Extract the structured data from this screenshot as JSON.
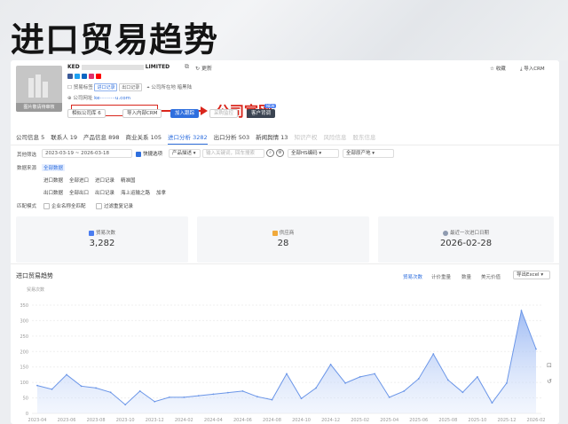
{
  "banner": {
    "title": "进口贸易趋势"
  },
  "company": {
    "logo_tag": "图片敬请待审核",
    "name_prefix": "KED",
    "name_suffix": "LIMITED",
    "update_label": "更新",
    "info_row1": {
      "label": "贸易标签",
      "pill1": "进口记录",
      "pill2": "出口记录",
      "addr_label": "公司所在地",
      "addr_value": "暗黑陆"
    },
    "info_row2": {
      "label": "公司网址",
      "url": "ke··········u.com"
    },
    "official_label": "公司官网"
  },
  "actions": {
    "compare": "相似公司库 6",
    "import_crm": "导入内部CRM",
    "follow": "加入跟踪",
    "disabled": "采购监控",
    "customer_profile": "客户背调",
    "new_badge": "NEW"
  },
  "top_right": {
    "collect": "收藏",
    "crm": "导入CRM"
  },
  "tabs": [
    {
      "label": "公司信息 5",
      "state": "normal"
    },
    {
      "label": "联系人 19",
      "state": "normal"
    },
    {
      "label": "产品信息 898",
      "state": "normal"
    },
    {
      "label": "商业关系 105",
      "state": "normal"
    },
    {
      "label": "进口分析 3282",
      "state": "active"
    },
    {
      "label": "出口分析 503",
      "state": "normal"
    },
    {
      "label": "新闻舆情 13",
      "state": "normal"
    },
    {
      "label": "知识产权",
      "state": "muted"
    },
    {
      "label": "风险信息",
      "state": "muted"
    },
    {
      "label": "股东信息",
      "state": "muted"
    }
  ],
  "filters": {
    "other_label": "其他筛选",
    "date_range": "2023-03-19  ~  2026-03-18",
    "quick": "快捷选项",
    "product_desc": "产品描述",
    "search_placeholder": "输入关键词，回车搜索",
    "hs_select": "全部HS编码",
    "origin_select": "全部原产地",
    "source_label": "数据来源",
    "source_all": "全部数据",
    "row2": [
      "进口数据",
      "全部进口",
      "进口记录",
      "精准国"
    ],
    "row3": [
      "出口数据",
      "全部出口",
      "出口记录",
      "海上运输之路",
      "加拿"
    ],
    "match_label": "匹配模式",
    "match_opts": [
      "企业名称全匹配",
      "过滤重复记录"
    ]
  },
  "stats": [
    {
      "label": "贸易次数",
      "value": "3,282",
      "color": "#4a7df0"
    },
    {
      "label": "供应商",
      "value": "28",
      "color": "#f0a93b"
    },
    {
      "label": "最近一次进口日期",
      "value": "2026-02-28",
      "color": "#8f9bb0"
    }
  ],
  "chart_section": {
    "title": "进口贸易趋势",
    "tabs": [
      "贸易次数",
      "计价重量",
      "数量",
      "美元价值"
    ],
    "export": "导出Excel"
  },
  "chart_data": {
    "type": "area",
    "ylabel": "贸易次数",
    "ylim": [
      0,
      350
    ],
    "yticks": [
      0,
      50,
      100,
      150,
      200,
      250,
      300,
      350
    ],
    "x": [
      "2023-04",
      "2023-05",
      "2023-06",
      "2023-07",
      "2023-08",
      "2023-09",
      "2023-10",
      "2023-11",
      "2023-12",
      "2024-01",
      "2024-02",
      "2024-03",
      "2024-04",
      "2024-05",
      "2024-06",
      "2024-07",
      "2024-08",
      "2024-09",
      "2024-10",
      "2024-11",
      "2024-12",
      "2025-01",
      "2025-02",
      "2025-03",
      "2025-04",
      "2025-05",
      "2025-06",
      "2025-07",
      "2025-08",
      "2025-09",
      "2025-10",
      "2025-11",
      "2025-12",
      "2026-01",
      "2026-02"
    ],
    "xticks": [
      "2023-04",
      "2023-06",
      "2023-08",
      "2023-10",
      "2023-12",
      "2024-02",
      "2024-04",
      "2024-06",
      "2024-08",
      "2024-10",
      "2024-12",
      "2025-02",
      "2025-04",
      "2025-06",
      "2025-08",
      "2025-10",
      "2025-12",
      "2026-02"
    ],
    "values": [
      90,
      78,
      125,
      88,
      82,
      68,
      28,
      72,
      38,
      52,
      52,
      57,
      62,
      67,
      72,
      54,
      44,
      128,
      48,
      82,
      158,
      98,
      118,
      128,
      52,
      72,
      112,
      192,
      108,
      68,
      118,
      34,
      98,
      332,
      208
    ]
  }
}
